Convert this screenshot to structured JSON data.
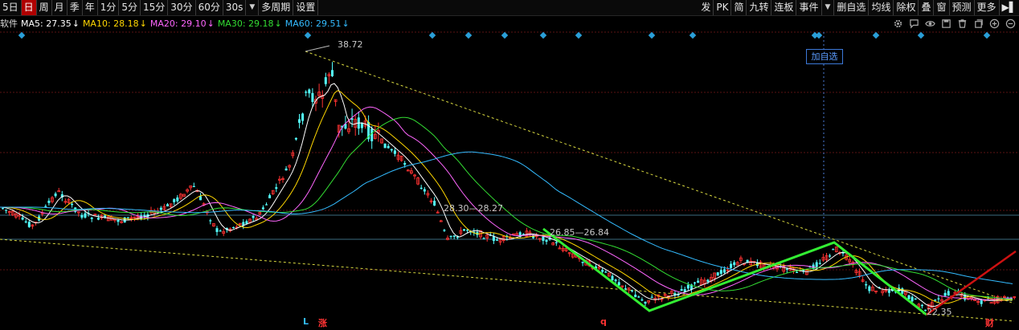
{
  "toolbar": {
    "periods": [
      "5日",
      "日",
      "周",
      "月",
      "季",
      "年",
      "1分",
      "5分",
      "15分",
      "30分",
      "60分",
      "30s"
    ],
    "active_period": "日",
    "multi_period": "多周期",
    "settings": "设置",
    "tools": [
      "发",
      "PK",
      "简",
      "九转",
      "连板",
      "事件"
    ],
    "tools_right": [
      "删自选",
      "均线",
      "除权",
      "叠",
      "窗",
      "预测",
      "更多"
    ]
  },
  "ma": {
    "prefix": "软件",
    "items": [
      {
        "label": "MA5: 27.35",
        "arrow": "↓",
        "color": "#ffffff"
      },
      {
        "label": "MA10: 28.18",
        "arrow": "↓",
        "color": "#ffd700"
      },
      {
        "label": "MA20: 29.10",
        "arrow": "↓",
        "color": "#ff66ff"
      },
      {
        "label": "MA30: 29.18",
        "arrow": "↓",
        "color": "#33dd33"
      },
      {
        "label": "MA60: 29.51",
        "arrow": "↓",
        "color": "#33bbff"
      }
    ]
  },
  "chart": {
    "high_label": "38.72",
    "range_label_1": "28.30—28.27",
    "range_label_2": "26.85—26.84",
    "low_label": "22.35",
    "add_watch": "加自选",
    "bottom_markers": [
      {
        "text": "L",
        "color": "#33bbff"
      },
      {
        "text": "涨",
        "color": "#ff3333"
      },
      {
        "text": "q",
        "color": "#ff3333"
      },
      {
        "text": "财",
        "color": "#ff3333"
      }
    ]
  },
  "colors": {
    "up": "#ff3232",
    "down": "#54ffff",
    "accent": "#b00000",
    "trend": "#33ee33"
  }
}
